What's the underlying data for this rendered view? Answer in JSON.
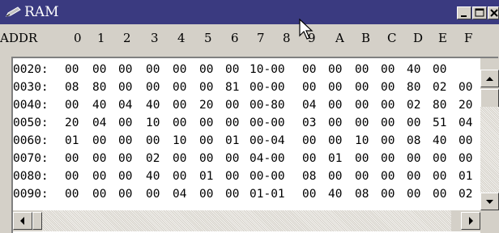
{
  "window": {
    "title": "RAM",
    "icon": "pencil-icon",
    "buttons": [
      "minimize-icon",
      "maximize-icon",
      "close-icon"
    ]
  },
  "columns": {
    "addr_label": "ADDR",
    "hex": [
      "0",
      "1",
      "2",
      "3",
      "4",
      "5",
      "6",
      "7",
      "8",
      "9",
      "A",
      "B",
      "C",
      "D",
      "E",
      "F"
    ]
  },
  "rows": [
    {
      "addr": "0020:",
      "bytes": [
        "00",
        "00",
        "00",
        "00",
        "00",
        "00",
        "00",
        "10-00",
        "00",
        "00",
        "00",
        "00",
        "40",
        "00"
      ]
    },
    {
      "addr": "0030:",
      "bytes": [
        "08",
        "80",
        "00",
        "00",
        "00",
        "00",
        "81",
        "00-00",
        "00",
        "00",
        "00",
        "00",
        "80",
        "02",
        "00"
      ]
    },
    {
      "addr": "0040:",
      "bytes": [
        "00",
        "40",
        "04",
        "40",
        "00",
        "20",
        "00",
        "00-80",
        "04",
        "00",
        "00",
        "00",
        "02",
        "80",
        "20"
      ]
    },
    {
      "addr": "0050:",
      "bytes": [
        "20",
        "04",
        "00",
        "10",
        "00",
        "00",
        "00",
        "00-00",
        "03",
        "00",
        "00",
        "00",
        "00",
        "51",
        "04"
      ]
    },
    {
      "addr": "0060:",
      "bytes": [
        "01",
        "00",
        "00",
        "00",
        "10",
        "00",
        "01",
        "00-04",
        "00",
        "00",
        "10",
        "00",
        "08",
        "40",
        "00"
      ]
    },
    {
      "addr": "0070:",
      "bytes": [
        "00",
        "00",
        "00",
        "02",
        "00",
        "00",
        "00",
        "04-00",
        "00",
        "01",
        "00",
        "00",
        "00",
        "00",
        "00"
      ]
    },
    {
      "addr": "0080:",
      "bytes": [
        "00",
        "00",
        "00",
        "40",
        "00",
        "01",
        "00",
        "00-00",
        "08",
        "00",
        "00",
        "00",
        "00",
        "00",
        "01"
      ]
    },
    {
      "addr": "0090:",
      "bytes": [
        "00",
        "00",
        "00",
        "00",
        "04",
        "00",
        "00",
        "01-01",
        "00",
        "40",
        "08",
        "00",
        "00",
        "00",
        "02"
      ]
    }
  ],
  "scrollbars": {
    "vertical": true,
    "horizontal": true
  }
}
